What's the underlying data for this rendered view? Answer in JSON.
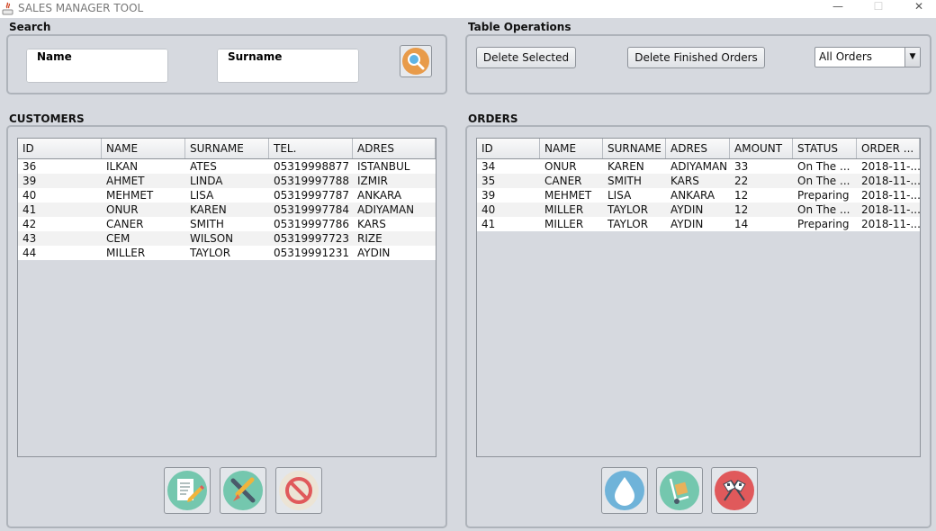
{
  "window": {
    "title": "SALES MANAGER TOOL",
    "minimize": "—",
    "maximize": "☐",
    "close": "✕"
  },
  "search": {
    "section_label": "Search",
    "name_label": "Name",
    "name_value": "",
    "surname_label": "Surname",
    "surname_value": ""
  },
  "table_ops": {
    "section_label": "Table Operations",
    "delete_selected": "Delete Selected",
    "delete_finished": "Delete Finished Orders",
    "filter_value": "All Orders"
  },
  "customers": {
    "section_label": "CUSTOMERS",
    "columns": [
      "ID",
      "NAME",
      "SURNAME",
      "TEL.",
      "ADRES"
    ],
    "rows": [
      [
        "36",
        "ILKAN",
        "ATES",
        "05319998877",
        "ISTANBUL"
      ],
      [
        "39",
        "AHMET",
        "LINDA",
        "05319997788",
        "IZMIR"
      ],
      [
        "40",
        "MEHMET",
        "LISA",
        "05319997787",
        "ANKARA"
      ],
      [
        "41",
        "ONUR",
        "KAREN",
        "05319997784",
        "ADIYAMAN"
      ],
      [
        "42",
        "CANER",
        "SMITH",
        "05319997786",
        "KARS"
      ],
      [
        "43",
        "CEM",
        "WILSON",
        "05319997723",
        "RIZE"
      ],
      [
        "44",
        "MILLER",
        "TAYLOR",
        "05319991231",
        "AYDIN"
      ]
    ],
    "action_icons": [
      "edit-note-icon",
      "paint-brush-icon",
      "prohibited-icon"
    ]
  },
  "orders": {
    "section_label": "ORDERS",
    "columns": [
      "ID",
      "NAME",
      "SURNAME",
      "ADRES",
      "AMOUNT",
      "STATUS",
      "ORDER ..."
    ],
    "rows": [
      [
        "34",
        "ONUR",
        "KAREN",
        "ADIYAMAN",
        "33",
        "On The ...",
        "2018-11-..."
      ],
      [
        "35",
        "CANER",
        "SMITH",
        "KARS",
        "22",
        "On The ...",
        "2018-11-..."
      ],
      [
        "39",
        "MEHMET",
        "LISA",
        "ANKARA",
        "12",
        "Preparing",
        "2018-11-..."
      ],
      [
        "40",
        "MILLER",
        "TAYLOR",
        "AYDIN",
        "12",
        "On The ...",
        "2018-11-..."
      ],
      [
        "41",
        "MILLER",
        "TAYLOR",
        "AYDIN",
        "14",
        "Preparing",
        "2018-11-..."
      ]
    ],
    "action_icons": [
      "water-drop-icon",
      "hand-truck-icon",
      "checkered-flags-icon"
    ]
  },
  "colors": {
    "panel_bg": "#d6d9df",
    "teal": "#74c7ae",
    "blue": "#6fb3d9",
    "red": "#e0595b"
  }
}
